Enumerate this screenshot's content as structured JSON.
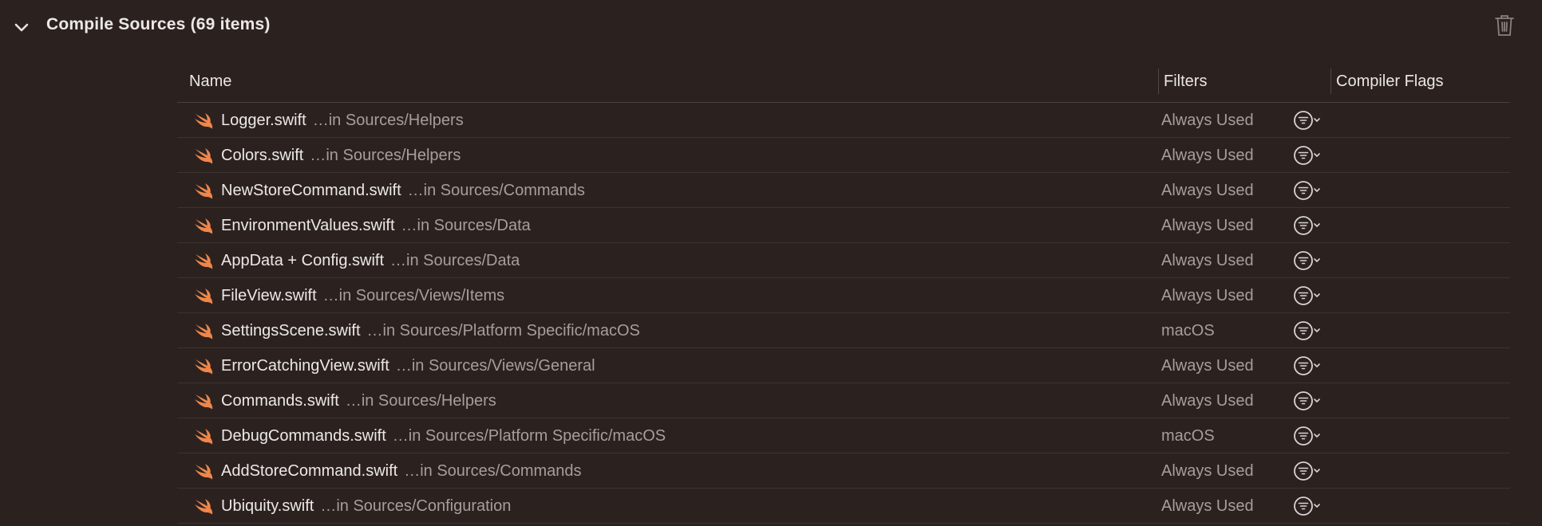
{
  "section": {
    "title": "Compile Sources (69 items)"
  },
  "table": {
    "columns": {
      "name": "Name",
      "filters": "Filters",
      "flags": "Compiler Flags"
    },
    "rows": [
      {
        "file": "Logger.swift",
        "path": "…in Sources/Helpers",
        "filter": "Always Used"
      },
      {
        "file": "Colors.swift",
        "path": "…in Sources/Helpers",
        "filter": "Always Used"
      },
      {
        "file": "NewStoreCommand.swift",
        "path": "…in Sources/Commands",
        "filter": "Always Used"
      },
      {
        "file": "EnvironmentValues.swift",
        "path": "…in Sources/Data",
        "filter": "Always Used"
      },
      {
        "file": "AppData + Config.swift",
        "path": "…in Sources/Data",
        "filter": "Always Used"
      },
      {
        "file": "FileView.swift",
        "path": "…in Sources/Views/Items",
        "filter": "Always Used"
      },
      {
        "file": "SettingsScene.swift",
        "path": "…in Sources/Platform Specific/macOS",
        "filter": "macOS"
      },
      {
        "file": "ErrorCatchingView.swift",
        "path": "…in Sources/Views/General",
        "filter": "Always Used"
      },
      {
        "file": "Commands.swift",
        "path": "…in Sources/Helpers",
        "filter": "Always Used"
      },
      {
        "file": "DebugCommands.swift",
        "path": "…in Sources/Platform Specific/macOS",
        "filter": "macOS"
      },
      {
        "file": "AddStoreCommand.swift",
        "path": "…in Sources/Commands",
        "filter": "Always Used"
      },
      {
        "file": "Ubiquity.swift",
        "path": "…in Sources/Configuration",
        "filter": "Always Used"
      }
    ]
  },
  "icons": {
    "collapse": "chevron-down-icon",
    "delete": "trash-icon",
    "file": "swift-icon",
    "filter": "filter-menu-icon"
  },
  "colors": {
    "background": "#2b2220",
    "swift_orange": "#f0864a",
    "secondary_text": "#a79e9b"
  }
}
